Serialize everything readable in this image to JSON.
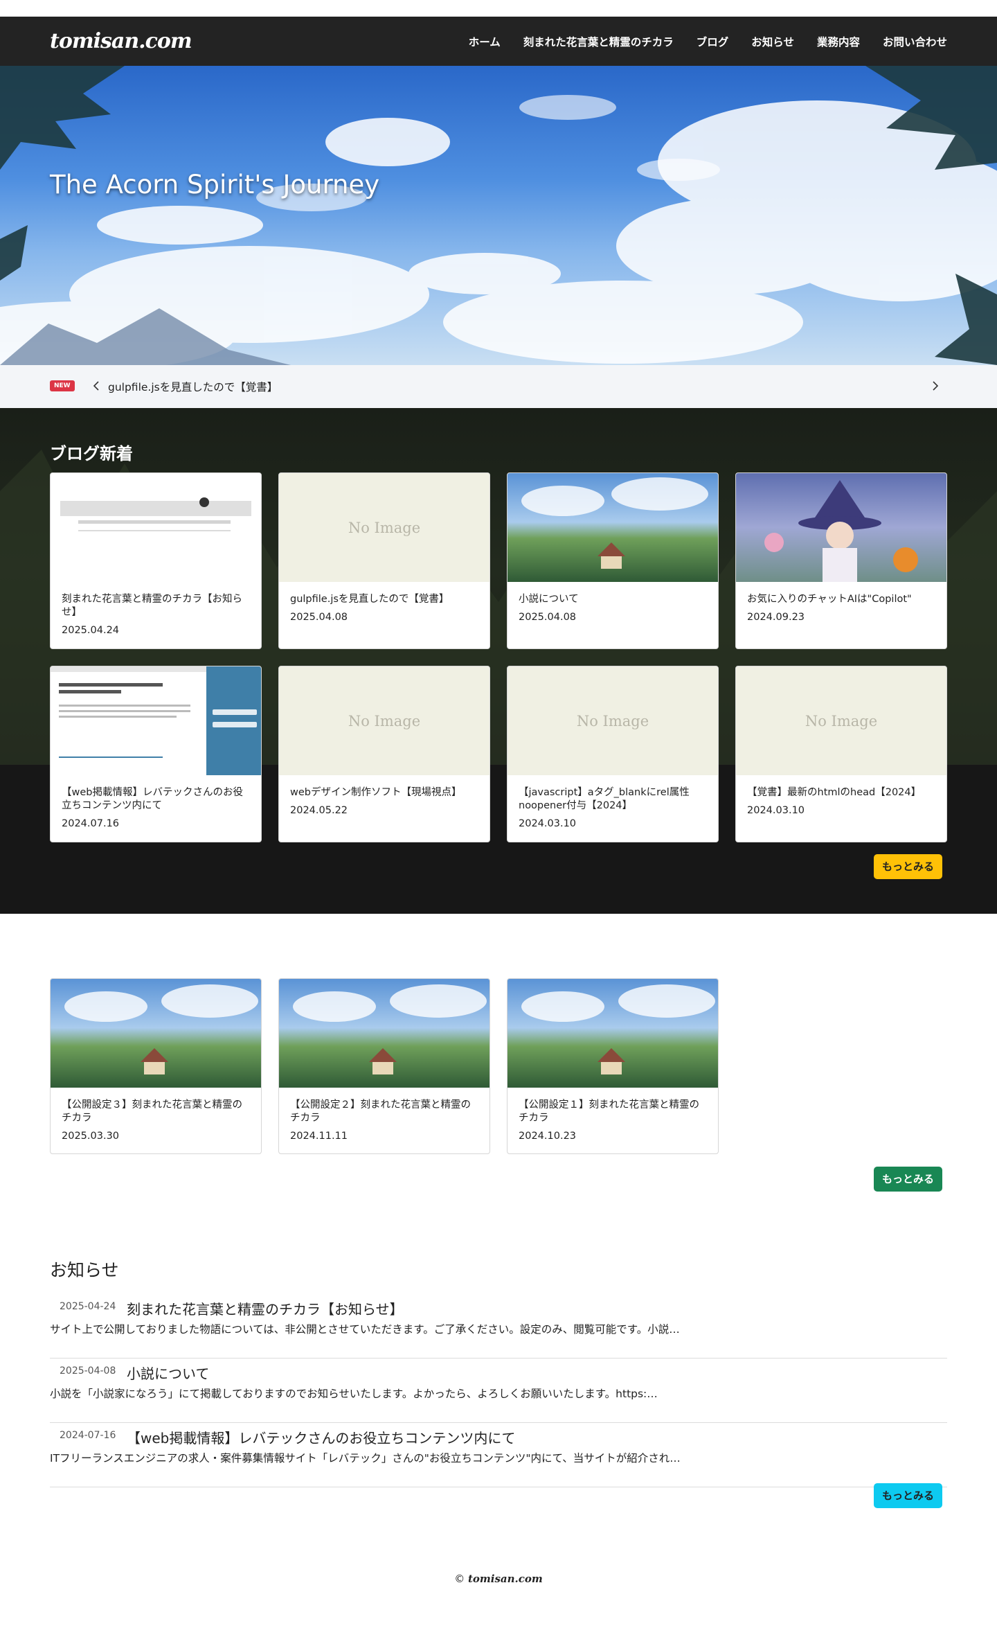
{
  "header": {
    "logo": "tomisan.com",
    "nav": [
      "ホーム",
      "刻まれた花言葉と精霊のチカラ",
      "ブログ",
      "お知らせ",
      "業務内容",
      "お問い合わせ"
    ]
  },
  "hero": {
    "title": "The Acorn Spirit's Journey"
  },
  "ticker": {
    "badge": "NEW",
    "text": "gulpfile.jsを見直したので【覚書】"
  },
  "blog": {
    "title": "ブログ新着",
    "more_label": "もっとみる",
    "no_image": "No Image",
    "cards": [
      {
        "title": "刻まれた花言葉と精霊のチカラ【お知らせ】",
        "date": "2025.04.24",
        "thumb": "title-image"
      },
      {
        "title": "gulpfile.jsを見直したので【覚書】",
        "date": "2025.04.08",
        "thumb": "no-image"
      },
      {
        "title": "小説について",
        "date": "2025.04.08",
        "thumb": "village-landscape"
      },
      {
        "title": "お気に入りのチャットAIは\"Copilot\"",
        "date": "2024.09.23",
        "thumb": "witch-illustration"
      },
      {
        "title": "【web掲載情報】レバテックさんのお役立ちコンテンツ内にて",
        "date": "2024.07.16",
        "thumb": "website-screenshot"
      },
      {
        "title": "webデザイン制作ソフト【現場視点】",
        "date": "2024.05.22",
        "thumb": "no-image"
      },
      {
        "title": "【javascript】aタグ_blankにrel属性noopener付与【2024】",
        "date": "2024.03.10",
        "thumb": "no-image"
      },
      {
        "title": "【覚書】最新のhtmlのhead【2024】",
        "date": "2024.03.10",
        "thumb": "no-image"
      }
    ]
  },
  "novel": {
    "more_label": "もっとみる",
    "cards": [
      {
        "title": "【公開設定３】刻まれた花言葉と精霊のチカラ",
        "date": "2025.03.30"
      },
      {
        "title": "【公開設定２】刻まれた花言葉と精霊のチカラ",
        "date": "2024.11.11"
      },
      {
        "title": "【公開設定１】刻まれた花言葉と精霊のチカラ",
        "date": "2024.10.23"
      }
    ]
  },
  "news": {
    "title": "お知らせ",
    "more_label": "もっとみる",
    "items": [
      {
        "date": "2025-04-24",
        "title": "刻まれた花言葉と精霊のチカラ【お知らせ】",
        "excerpt": "サイト上で公開しておりました物語については、非公開とさせていただきます。ご了承ください。設定のみ、閲覧可能です。小説…"
      },
      {
        "date": "2025-04-08",
        "title": "小説について",
        "excerpt": "小説を「小説家になろう」にて掲載しておりますのでお知らせいたします。よかったら、よろしくお願いいたします。https:…"
      },
      {
        "date": "2024-07-16",
        "title": "【web掲載情報】レバテックさんのお役立ちコンテンツ内にて",
        "excerpt": "ITフリーランスエンジニアの求人・案件募集情報サイト「レバテック」さんの\"お役立ちコンテンツ\"内にて、当サイトが紹介され…"
      }
    ]
  },
  "footer": {
    "copyright": "©",
    "logo": "tomisan.com"
  },
  "colors": {
    "header_bg": "#232323",
    "blog_bg": "#171717",
    "badge_red": "#dc3545",
    "more_yellow": "#ffc107",
    "more_green": "#198754",
    "more_cyan": "#0dcaf0"
  }
}
